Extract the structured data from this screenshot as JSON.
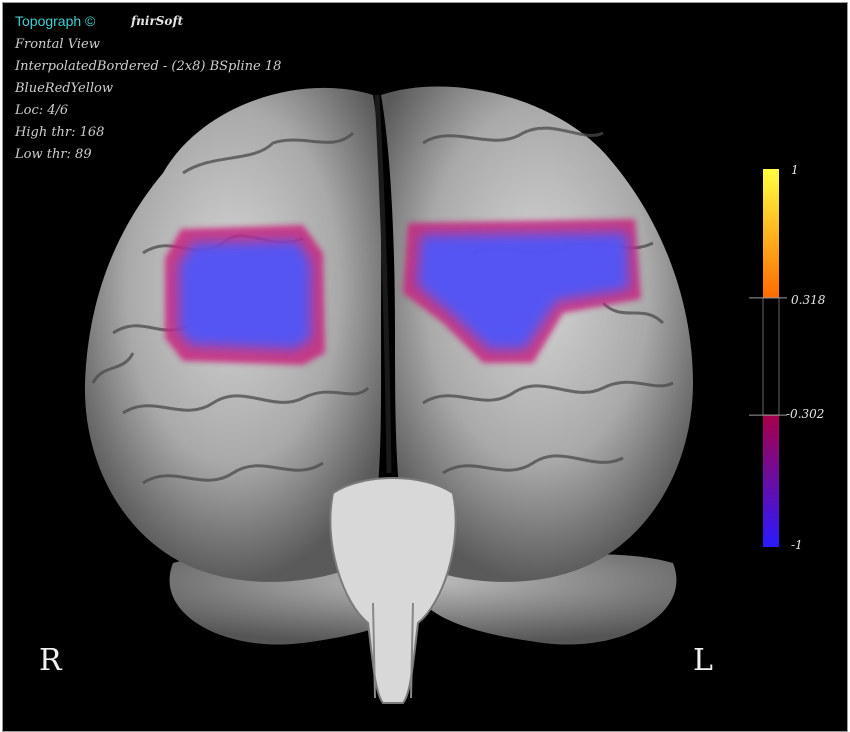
{
  "header": {
    "app_title": "Topograph ©",
    "vendor": "fnirSoft"
  },
  "info_lines": [
    "Frontal View",
    "InterpolatedBordered - (2x8) BSpline 18",
    "BlueRedYellow",
    "Loc: 4/6",
    "High thr: 168",
    "Low thr: 89"
  ],
  "orientation": {
    "right_label": "R",
    "left_label": "L"
  },
  "colorbar": {
    "labels": {
      "max": "1",
      "upper_threshold": "0.318",
      "lower_threshold": "-0.302",
      "min": "-1"
    },
    "values": {
      "max": 1,
      "upper_threshold": 0.318,
      "lower_threshold": -0.302,
      "min": -1
    },
    "colors": {
      "top": "#ffff40",
      "upper": "#ff6a00",
      "lower": "#a8004a",
      "bottom": "#2a1aff",
      "gap": "#000000"
    }
  },
  "overlay": {
    "colors": {
      "core": "#5060ff",
      "edge": "#d0308c"
    }
  }
}
